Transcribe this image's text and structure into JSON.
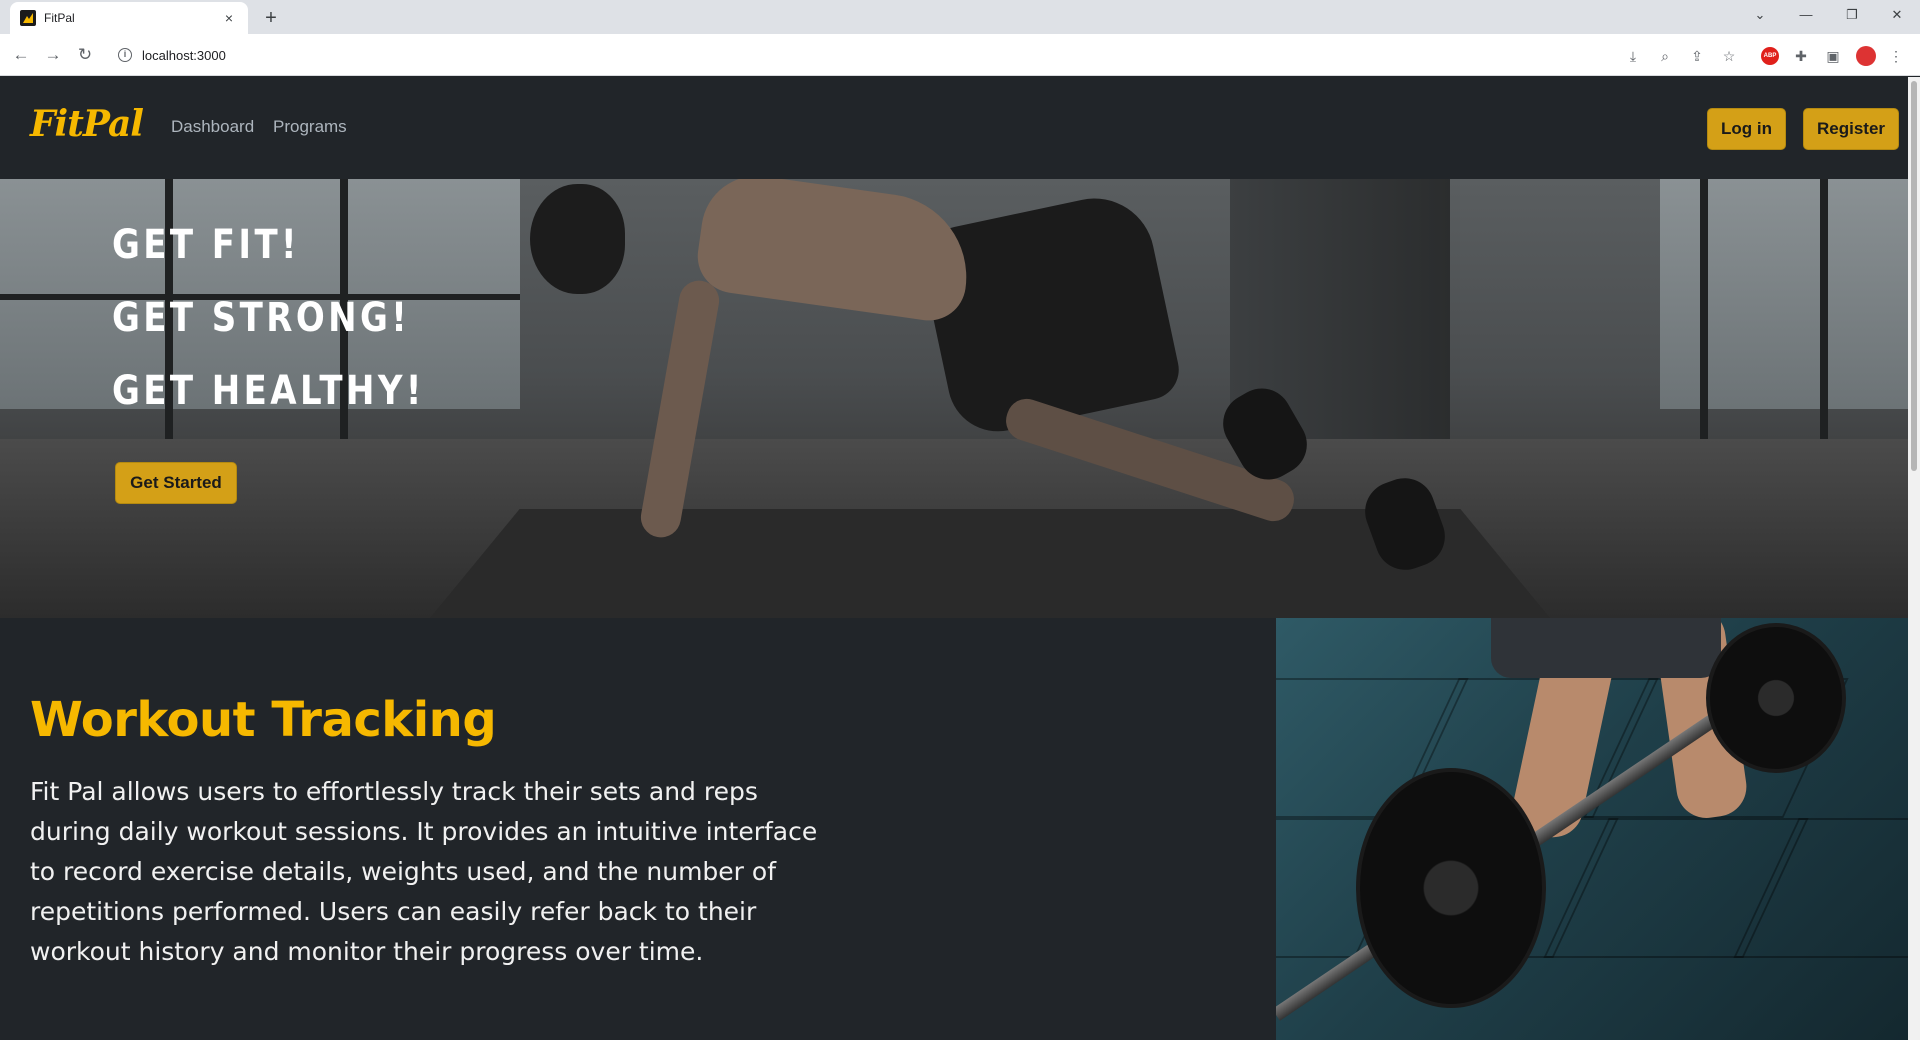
{
  "browser": {
    "tab_title": "FitPal",
    "tab_close": "×",
    "new_tab": "+",
    "url": "localhost:3000",
    "controls": {
      "dropdown": "⌄",
      "minimize": "—",
      "restore": "❐",
      "close": "✕"
    },
    "toolbar_icons": [
      "back-icon",
      "forward-icon",
      "reload-icon",
      "install-icon",
      "zoom-icon",
      "share-icon",
      "bookmark-star-icon",
      "adblock-icon",
      "extensions-icon",
      "sidepanel-icon",
      "profile-avatar",
      "menu-icon"
    ],
    "back": "←",
    "forward": "→",
    "reload": "↻"
  },
  "nav": {
    "logo": "FitPal",
    "links": [
      "Dashboard",
      "Programs"
    ],
    "login": "Log in",
    "register": "Register"
  },
  "hero": {
    "lines": [
      "GET FIT!",
      "GET STRONG!",
      "GET HEALTHY!"
    ],
    "cta": "Get Started"
  },
  "feature": {
    "title": "Workout Tracking",
    "description": "Fit Pal allows users to effortlessly track their sets and reps during daily workout sessions. It provides an intuitive interface to record exercise details, weights used, and the number of repetitions performed. Users can easily refer back to their workout history and monitor their progress over time."
  },
  "colors": {
    "accent": "#f6b800",
    "button": "#d4a017",
    "background": "#212529"
  }
}
